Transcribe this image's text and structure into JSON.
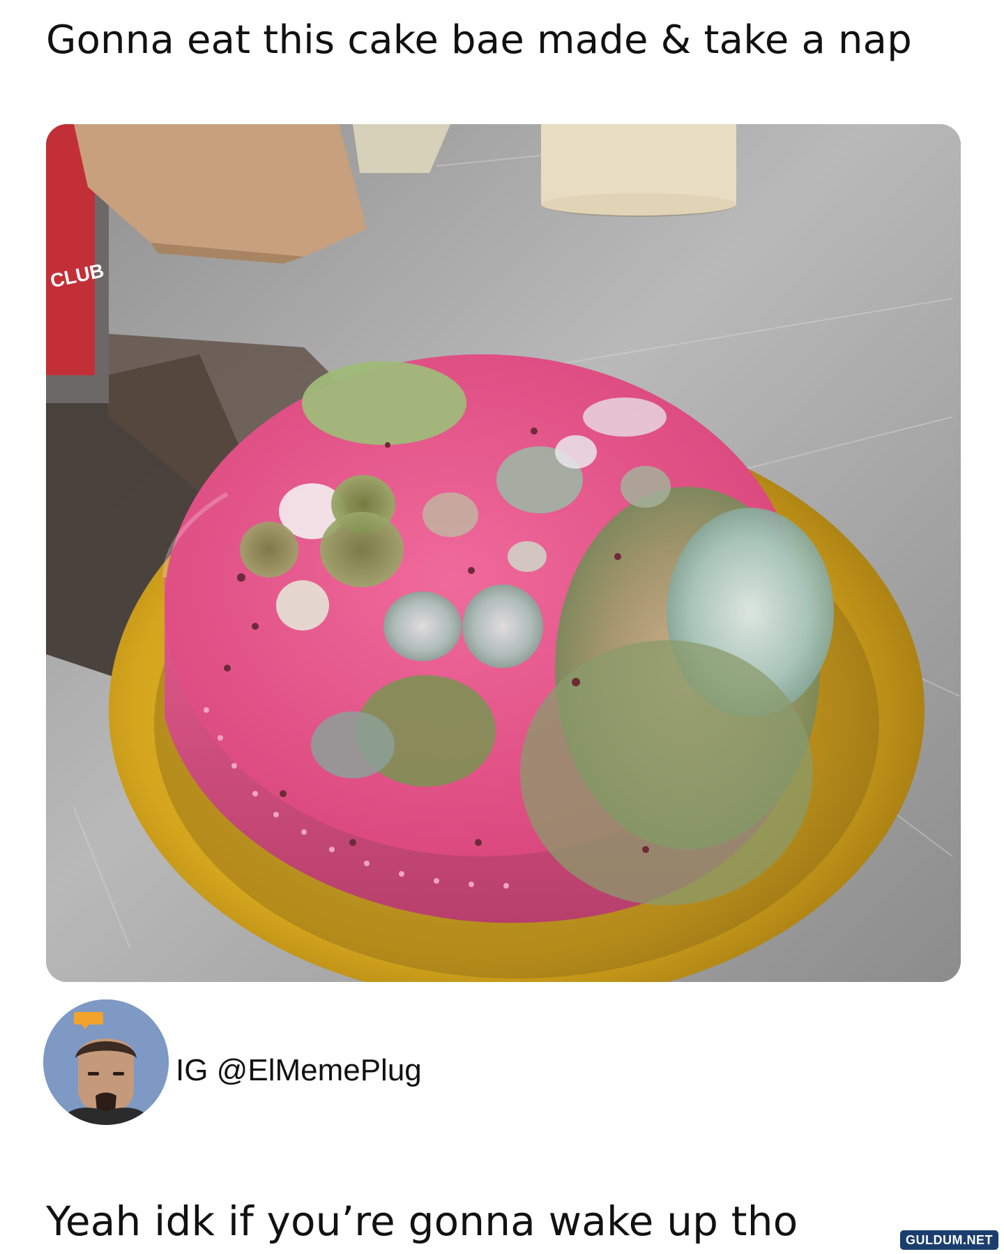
{
  "post": {
    "top_caption": "Gonna eat this cake bae made & take a nap",
    "photo_icon": "moldy-cake-photo",
    "author": {
      "avatar_icon": "cartoon-avatar-icon",
      "handle": "IG @ElMemePlug"
    },
    "bottom_caption": "Yeah idk if you’re gonna wake up tho"
  },
  "watermark": {
    "text": "GULDUM.NET"
  },
  "colors": {
    "background": "#ffffff",
    "text": "#111111",
    "avatar_bg": "#7d99c4",
    "cake_pink": "#e8568a",
    "mold_green": "#7e9454",
    "cake_board_gold": "#d7a820",
    "watermark_bg": "#1a3e6e"
  }
}
